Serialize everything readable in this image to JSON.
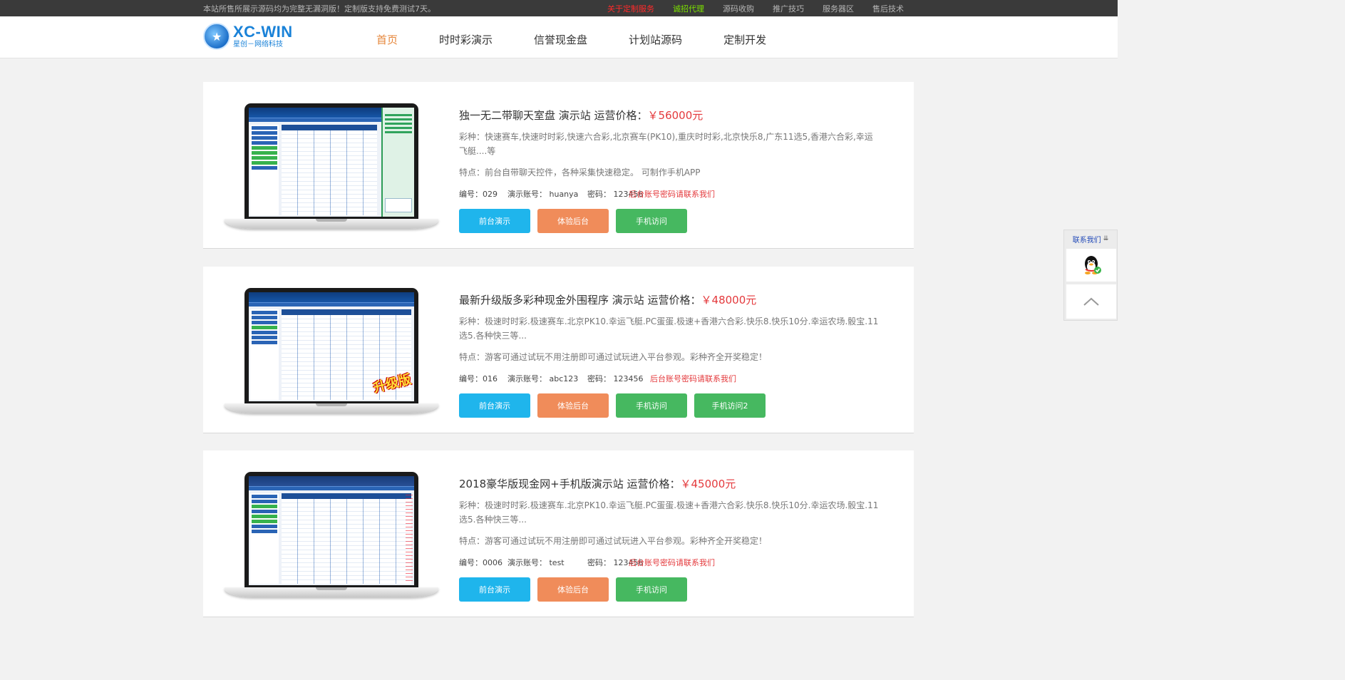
{
  "topbar": {
    "notice": "本站所售所展示源码均为完整无漏洞版！定制版支持免费测试7天。",
    "links": [
      "关于定制服务",
      "诚招代理",
      "源码收购",
      "推广技巧",
      "服务器区",
      "售后技术"
    ]
  },
  "header": {
    "logo_main": "XC-WIN",
    "logo_sub": "星创－网络科技",
    "nav": [
      "首页",
      "时时彩演示",
      "信誉现金盘",
      "计划站源码",
      "定制开发"
    ]
  },
  "products": [
    {
      "title": "独一无二带聊天室盘 演示站 运营价格：",
      "price": "￥56000元",
      "desc": "彩种：快速赛车,快速时时彩,快速六合彩,北京赛车(PK10),重庆时时彩,北京快乐8,广东11选5,香港六合彩,幸运飞艇....等",
      "feature": "特点：前台自带聊天控件，各种采集快速稳定。 可制作手机APP",
      "code": "编号：029",
      "account": "演示账号：  huanya",
      "password": "密码：  123456",
      "warn": "后台账号密码请联系我们",
      "buttons": [
        "前台演示",
        "体验后台",
        "手机访问"
      ]
    },
    {
      "title": "最新升级版多彩种现金外围程序 演示站 运营价格：",
      "price": "￥48000元",
      "desc": "彩种：极速时时彩.极速赛车.北京PK10.幸运飞艇.PC蛋蛋.极速+香港六合彩.快乐8.快乐10分.幸运农场.骰宝.11选5.各种快三等...",
      "feature": "特点：游客可通过试玩不用注册即可通过试玩进入平台参观。彩种齐全开奖稳定！",
      "code": "编号：016",
      "account": "演示账号：  abc123",
      "password": "密码：  123456",
      "warn": "后台账号密码请联系我们",
      "badge": "升级版",
      "buttons": [
        "前台演示",
        "体验后台",
        "手机访问",
        "手机访问2"
      ]
    },
    {
      "title": "2018豪华版现金网+手机版演示站 运营价格：",
      "price": "￥45000元",
      "desc": "彩种：极速时时彩.极速赛车.北京PK10.幸运飞艇.PC蛋蛋.极速+香港六合彩.快乐8.快乐10分.幸运农场.骰宝.11选5.各种快三等...",
      "feature": "特点：游客可通过试玩不用注册即可通过试玩进入平台参观。彩种齐全开奖稳定！",
      "code": "编号：0006",
      "account": "演示账号：  test",
      "password": "密码：  123456",
      "warn": "后台账号密码请联系我们",
      "buttons": [
        "前台演示",
        "体验后台",
        "手机访问"
      ]
    }
  ],
  "float": {
    "title": "联系我们"
  },
  "icons": {
    "qq": "qq-penguin-icon",
    "back_to_top": "chevron-up-icon",
    "collapse": "double-chevron-down-icon"
  }
}
